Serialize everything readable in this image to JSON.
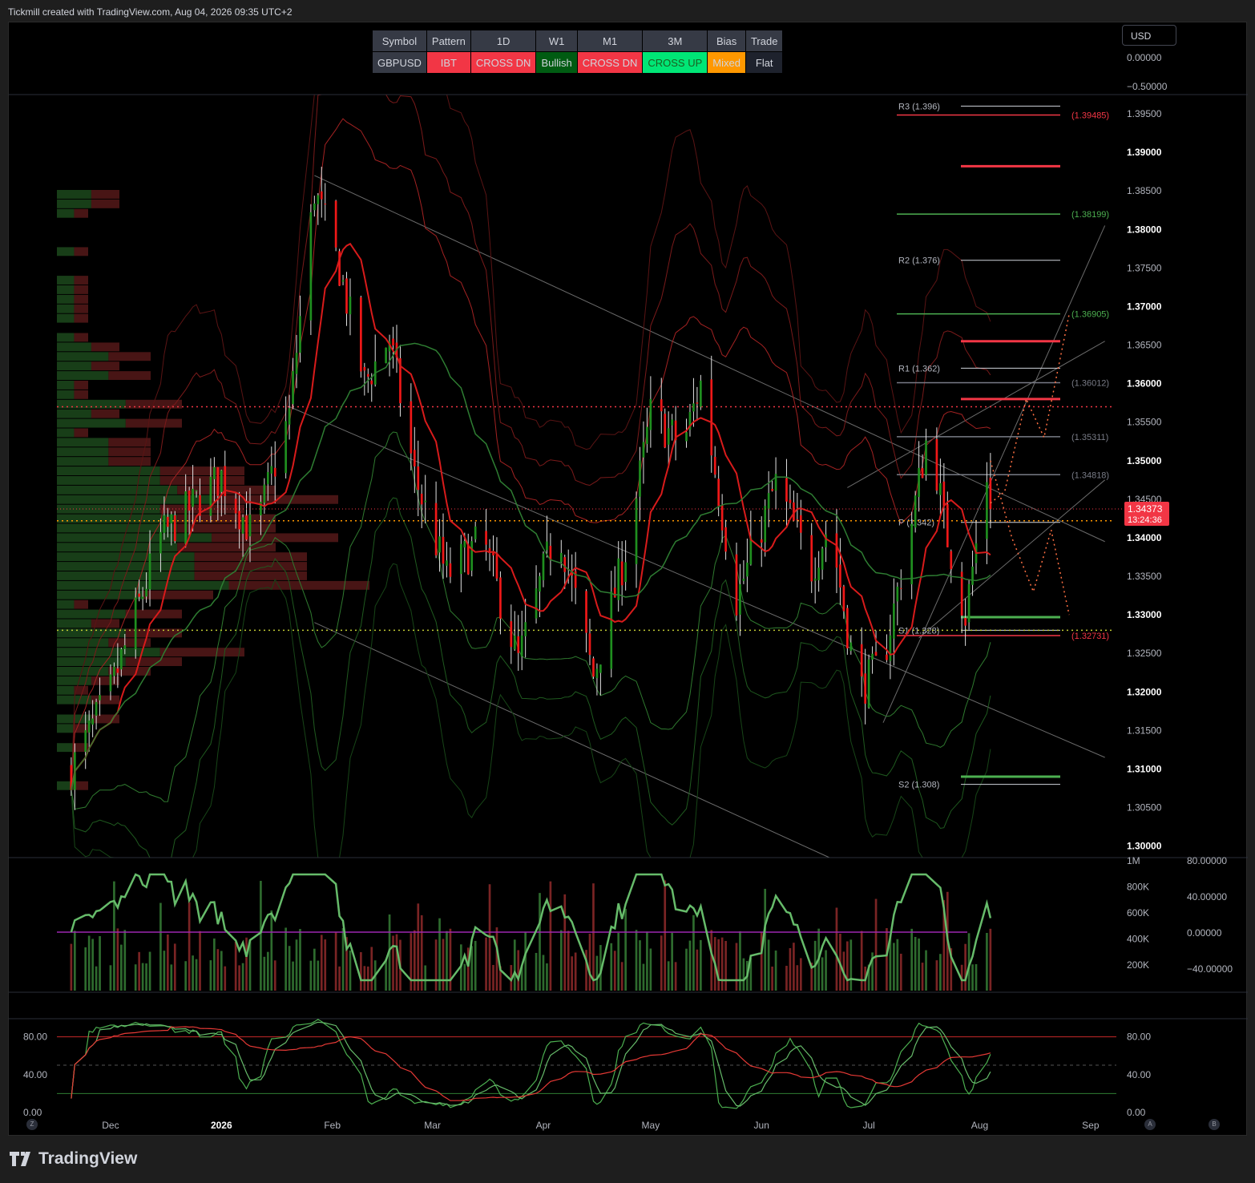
{
  "header": {
    "attribution": "Tickmill created with TradingView.com, Aug 04, 2026 09:35 UTC+2"
  },
  "table": {
    "headers": [
      "Symbol",
      "Pattern",
      "1D",
      "W1",
      "M1",
      "3M",
      "Bias",
      "Trade"
    ],
    "values": [
      "GBPUSD",
      "IBT",
      "CROSS DN",
      "Bullish",
      "CROSS DN",
      "CROSS UP",
      "Mixed",
      "Flat"
    ],
    "cell_colors": [
      "#363a45",
      "#f23645",
      "#f23645",
      "#005b12",
      "#f23645",
      "#00e676",
      "#ff9800",
      "#1e222d"
    ],
    "text_colors": [
      "#d1d4dc",
      "#d1d4dc",
      "#d1d4dc",
      "#d1d4dc",
      "#d1d4dc",
      "#1b5e20",
      "#d1d4dc",
      "#d1d4dc"
    ]
  },
  "currency_button": "USD",
  "footer": {
    "brand": "TradingView"
  },
  "buttons": {
    "z": "Z",
    "a": "A",
    "b": "B"
  },
  "colors": {
    "bull": "#1f8f1f",
    "bear": "#f01818",
    "background": "#000000"
  },
  "chart_data": [
    {
      "type": "candlestick",
      "symbol": "GBPUSD",
      "ylim": [
        1.2985,
        1.3975
      ],
      "y_ticks": [
        "1.39500",
        "1.39000",
        "1.38500",
        "1.38000",
        "1.37500",
        "1.37000",
        "1.36500",
        "1.36000",
        "1.35500",
        "1.35000",
        "1.34500",
        "1.34000",
        "1.33500",
        "1.33000",
        "1.32500",
        "1.32000",
        "1.31500",
        "1.31000",
        "1.30500",
        "1.30000"
      ],
      "y_ticks_bold": [
        "1.39000",
        "1.38000",
        "1.37000",
        "1.36000",
        "1.35000",
        "1.34000",
        "1.33000",
        "1.32000",
        "1.31000",
        "1.30000"
      ],
      "x_labels": [
        "Dec",
        "2026",
        "Feb",
        "Mar",
        "Apr",
        "May",
        "Jun",
        "Jul",
        "Aug",
        "Sep"
      ],
      "x_labels_bold": [
        "2026"
      ],
      "top_scale": [
        "0.00000",
        "−0.50000"
      ],
      "price_path": [
        {
          "date": "2025-11-20",
          "price": 1.31
        },
        {
          "date": "2025-12-01",
          "price": 1.32
        },
        {
          "date": "2025-12-15",
          "price": 1.34
        },
        {
          "date": "2026-01-01",
          "price": 1.348
        },
        {
          "date": "2026-01-10",
          "price": 1.34
        },
        {
          "date": "2026-01-20",
          "price": 1.356
        },
        {
          "date": "2026-01-27",
          "price": 1.385
        },
        {
          "date": "2026-02-03",
          "price": 1.375
        },
        {
          "date": "2026-02-10",
          "price": 1.36
        },
        {
          "date": "2026-02-17",
          "price": 1.366
        },
        {
          "date": "2026-02-24",
          "price": 1.348
        },
        {
          "date": "2026-03-05",
          "price": 1.335
        },
        {
          "date": "2026-03-15",
          "price": 1.34
        },
        {
          "date": "2026-03-25",
          "price": 1.324
        },
        {
          "date": "2026-04-05",
          "price": 1.342
        },
        {
          "date": "2026-04-15",
          "price": 1.322
        },
        {
          "date": "2026-04-25",
          "price": 1.34
        },
        {
          "date": "2026-05-01",
          "price": 1.356
        },
        {
          "date": "2026-05-10",
          "price": 1.352
        },
        {
          "date": "2026-05-15",
          "price": 1.36
        },
        {
          "date": "2026-05-25",
          "price": 1.332
        },
        {
          "date": "2026-06-05",
          "price": 1.347
        },
        {
          "date": "2026-06-15",
          "price": 1.336
        },
        {
          "date": "2026-06-20",
          "price": 1.342
        },
        {
          "date": "2026-06-28",
          "price": 1.32
        },
        {
          "date": "2026-07-05",
          "price": 1.324
        },
        {
          "date": "2026-07-13",
          "price": 1.342
        },
        {
          "date": "2026-07-18",
          "price": 1.355
        },
        {
          "date": "2026-07-22",
          "price": 1.342
        },
        {
          "date": "2026-07-28",
          "price": 1.33
        },
        {
          "date": "2026-08-03",
          "price": 1.348
        },
        {
          "date": "2026-08-04",
          "price": 1.3437
        }
      ],
      "last_price": {
        "price": "1.34373",
        "time": "13:24:36",
        "value": 1.34373
      },
      "pivots": [
        {
          "label": "R3 (1.396)",
          "value": 1.396
        },
        {
          "label": "R2 (1.376)",
          "value": 1.376
        },
        {
          "label": "R1 (1.362)",
          "value": 1.362
        },
        {
          "label": "P (1.342)",
          "value": 1.342
        },
        {
          "label": "S1 (1.328)",
          "value": 1.328
        },
        {
          "label": "S2 (1.308)",
          "value": 1.308
        }
      ],
      "levels": [
        {
          "label": "(1.39485)",
          "value": 1.39485,
          "color": "#f23645"
        },
        {
          "label": "(1.38199)",
          "value": 1.38199,
          "color": "#4caf50"
        },
        {
          "label": "(1.36905)",
          "value": 1.36905,
          "color": "#4caf50"
        },
        {
          "label": "(1.36012)",
          "value": 1.36012,
          "color": "#787b86"
        },
        {
          "label": "(1.35311)",
          "value": 1.35311,
          "color": "#787b86"
        },
        {
          "label": "(1.34818)",
          "value": 1.34818,
          "color": "#787b86"
        },
        {
          "label": "(1.32731)",
          "value": 1.32731,
          "color": "#f23645"
        }
      ],
      "dotted_levels": [
        {
          "value": 1.357,
          "color": "#f23645"
        },
        {
          "value": 1.3422,
          "color": "#ff9800"
        },
        {
          "value": 1.328,
          "color": "#c0ca33"
        }
      ]
    },
    {
      "type": "bar",
      "name": "volume",
      "y_ticks": [
        "1M",
        "800K",
        "600K",
        "400K",
        "200K"
      ],
      "oscillator_ticks": [
        "80.00000",
        "40.00000",
        "0.00000",
        "−40.00000"
      ]
    },
    {
      "type": "line",
      "name": "stochastic",
      "y_ticks_left": [
        "80.00",
        "40.00",
        "0.00"
      ],
      "y_ticks_right": [
        "80.00",
        "40.00",
        "0.00"
      ],
      "levels": [
        80,
        50,
        20
      ]
    }
  ]
}
